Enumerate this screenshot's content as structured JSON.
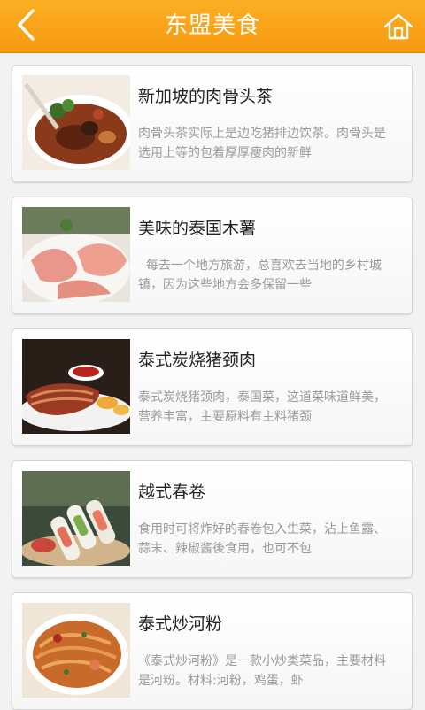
{
  "header": {
    "title": "东盟美食",
    "back_icon": "chevron-left-icon",
    "home_icon": "home-icon",
    "bar_color": "#f9a318"
  },
  "foods": [
    {
      "title": "新加坡的肉骨头茶",
      "desc": "肉骨头茶实际上是边吃猪排边饮茶。肉骨头是选用上等的包着厚厚瘦肉的新鲜",
      "image": "bak-kut-teh-bowl"
    },
    {
      "title": "美味的泰国木薯",
      "desc": "  每去一个地方旅游，总喜欢去当地的乡村城镇，因为这些地方会多保留一些",
      "image": "thai-cassava-rice"
    },
    {
      "title": "泰式炭烧猪颈肉",
      "desc": "泰式炭烧猪颈肉，泰国菜，这道菜味道鲜美，营养丰富，主要原料有主料猪颈",
      "image": "grilled-pork-neck"
    },
    {
      "title": "越式春卷",
      "desc": "食用时可将炸好的春卷包入生菜，沾上鱼露、蒜末、辣椒酱後食用，也可不包",
      "image": "vietnamese-spring-rolls"
    },
    {
      "title": "泰式炒河粉",
      "desc": "《泰式炒河粉》是一款小炒类菜品，主要材料是河粉。材料:河粉，鸡蛋，虾",
      "image": "pad-thai-noodles"
    }
  ]
}
